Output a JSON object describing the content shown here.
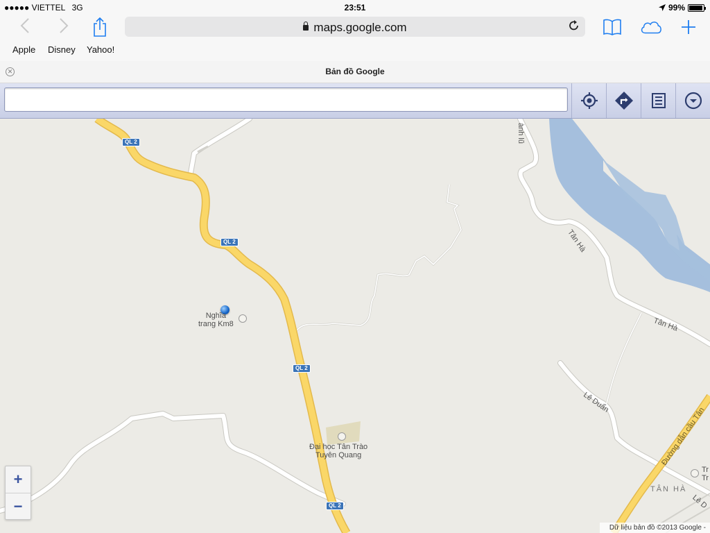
{
  "status_bar": {
    "signal": "●●●●●",
    "carrier": "VIETTEL",
    "network": "3G",
    "time": "23:51",
    "battery": "99%"
  },
  "browser": {
    "url": "maps.google.com",
    "bookmarks": [
      "Apple",
      "Disney",
      "Yahoo!"
    ],
    "tab_title": "Bản đồ Google"
  },
  "maps": {
    "search_value": "",
    "search_placeholder": "",
    "attribution": "Dữ liệu bản đồ ©2013 Google -"
  },
  "map_labels": {
    "road_shield": "QL 2",
    "cemetery": [
      "Nghĩa",
      "trang Km8"
    ],
    "university": [
      "Đại học Tân Trào",
      "Tuyên Quang"
    ],
    "street_tan_ha_1": "Tân Hà",
    "street_tan_ha_2": "Tân Hà",
    "street_le_duan": "Lê Duẩn",
    "street_le_duan_2": "Lê D",
    "street_thanh_lu": "ành lũ",
    "bridge_road": "Đường dẫn cầu Tân",
    "area_tan_ha": "TÂN HÀ",
    "school_partial": [
      "Tr",
      "Tr"
    ]
  },
  "colors": {
    "map_bg": "#ecebe6",
    "highway": "#fad768",
    "highway_edge": "#e3b94c",
    "water": "#a5bfdd",
    "road": "#ffffff",
    "ios_blue": "#1f7ef0"
  }
}
